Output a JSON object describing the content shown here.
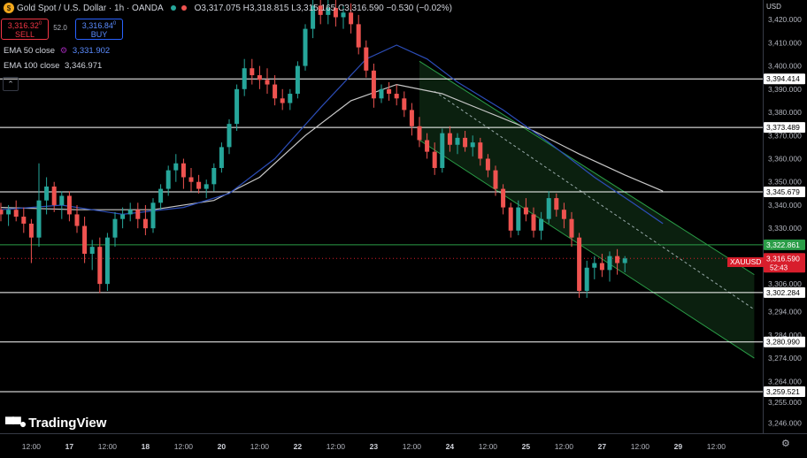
{
  "header": {
    "title": "Gold Spot / U.S. Dollar · 1h · OANDA",
    "ohlc": "O3,317.075 H3,318.815 L3,315.165 C3,316.590 −0.530 (−0.02%)"
  },
  "trade": {
    "sell_price": "3,316.32",
    "sell_sup": "0",
    "sell_label": "SELL",
    "spread": "52.0",
    "buy_price": "3,316.84",
    "buy_sup": "0",
    "buy_label": "BUY"
  },
  "indicators": {
    "ema50_label": "EMA 50 close",
    "ema50_value": "3,331.902",
    "ema100_label": "EMA 100 close",
    "ema100_value": "3,346.971"
  },
  "brand": "TradingView",
  "colors": {
    "up": "#26a69a",
    "down": "#ef5350",
    "ema50": "#2c4db8",
    "ema100": "#c8c8c8",
    "channel": "#2a9d47",
    "level": "#ffffff"
  },
  "chart_data": {
    "type": "candlestick",
    "currency": "USD",
    "symbol": "XAUUSD",
    "last_price": "3,316.590",
    "countdown": "52:43",
    "y_range": [
      3242,
      3425
    ],
    "y_ticks": [
      {
        "v": 3420,
        "label": "3,420.000"
      },
      {
        "v": 3410,
        "label": "3,410.000"
      },
      {
        "v": 3400,
        "label": "3,400.000"
      },
      {
        "v": 3390,
        "label": "3,390.000"
      },
      {
        "v": 3380,
        "label": "3,380.000"
      },
      {
        "v": 3370,
        "label": "3,370.000"
      },
      {
        "v": 3360,
        "label": "3,360.000"
      },
      {
        "v": 3350,
        "label": "3,350.000"
      },
      {
        "v": 3340,
        "label": "3,340.000"
      },
      {
        "v": 3330,
        "label": "3,330.000"
      },
      {
        "v": 3306,
        "label": "3,306.000"
      },
      {
        "v": 3294,
        "label": "3,294.000"
      },
      {
        "v": 3284,
        "label": "3,284.000"
      },
      {
        "v": 3274,
        "label": "3,274.000"
      },
      {
        "v": 3264,
        "label": "3,264.000"
      },
      {
        "v": 3255,
        "label": "3,255.000"
      },
      {
        "v": 3246,
        "label": "3,246.000"
      }
    ],
    "levels": [
      {
        "v": 3394.414,
        "label": "3,394.414"
      },
      {
        "v": 3373.489,
        "label": "3,373.489"
      },
      {
        "v": 3345.679,
        "label": "3,345.679"
      },
      {
        "v": 3302.284,
        "label": "3,302.284"
      },
      {
        "v": 3280.99,
        "label": "3,280.990"
      },
      {
        "v": 3259.521,
        "label": "3,259.521"
      }
    ],
    "green_level": {
      "v": 3322.861,
      "label": "3,322.861"
    },
    "x_ticks": [
      {
        "i": 4,
        "label": "12:00",
        "bold": false
      },
      {
        "i": 9,
        "label": "17",
        "bold": true
      },
      {
        "i": 14,
        "label": "12:00",
        "bold": false
      },
      {
        "i": 19,
        "label": "18",
        "bold": true
      },
      {
        "i": 24,
        "label": "12:00",
        "bold": false
      },
      {
        "i": 29,
        "label": "20",
        "bold": true
      },
      {
        "i": 34,
        "label": "12:00",
        "bold": false
      },
      {
        "i": 39,
        "label": "22",
        "bold": true
      },
      {
        "i": 44,
        "label": "12:00",
        "bold": false
      },
      {
        "i": 49,
        "label": "23",
        "bold": true
      },
      {
        "i": 54,
        "label": "12:00",
        "bold": false
      },
      {
        "i": 59,
        "label": "24",
        "bold": true
      },
      {
        "i": 64,
        "label": "12:00",
        "bold": false
      },
      {
        "i": 69,
        "label": "25",
        "bold": true
      },
      {
        "i": 74,
        "label": "12:00",
        "bold": false
      },
      {
        "i": 79,
        "label": "27",
        "bold": true
      },
      {
        "i": 84,
        "label": "12:00",
        "bold": false
      },
      {
        "i": 89,
        "label": "29",
        "bold": true
      },
      {
        "i": 94,
        "label": "12:00",
        "bold": false
      }
    ],
    "channel": {
      "upper": [
        [
          55,
          3402
        ],
        [
          99,
          3310
        ]
      ],
      "mid": [
        [
          57,
          3389
        ],
        [
          99,
          3295
        ]
      ],
      "lower": [
        [
          55,
          3368
        ],
        [
          99,
          3274
        ]
      ]
    },
    "candles": [
      [
        3338,
        3341,
        3333,
        3336
      ],
      [
        3336,
        3340,
        3331,
        3338
      ],
      [
        3338,
        3342,
        3333,
        3335
      ],
      [
        3335,
        3339,
        3328,
        3332
      ],
      [
        3332,
        3334,
        3315,
        3326
      ],
      [
        3326,
        3358,
        3322,
        3342
      ],
      [
        3342,
        3352,
        3336,
        3348
      ],
      [
        3348,
        3350,
        3337,
        3340
      ],
      [
        3340,
        3346,
        3334,
        3344
      ],
      [
        3344,
        3346,
        3333,
        3336
      ],
      [
        3336,
        3340,
        3328,
        3331
      ],
      [
        3331,
        3335,
        3315,
        3319
      ],
      [
        3319,
        3325,
        3312,
        3322
      ],
      [
        3322,
        3326,
        3302,
        3306
      ],
      [
        3306,
        3328,
        3303,
        3326
      ],
      [
        3326,
        3337,
        3322,
        3334
      ],
      [
        3334,
        3339,
        3330,
        3336
      ],
      [
        3336,
        3341,
        3333,
        3338
      ],
      [
        3338,
        3341,
        3330,
        3334
      ],
      [
        3334,
        3340,
        3327,
        3330
      ],
      [
        3330,
        3343,
        3328,
        3341
      ],
      [
        3341,
        3349,
        3338,
        3347
      ],
      [
        3347,
        3357,
        3344,
        3355
      ],
      [
        3355,
        3362,
        3350,
        3358
      ],
      [
        3358,
        3360,
        3347,
        3352
      ],
      [
        3352,
        3356,
        3346,
        3350
      ],
      [
        3350,
        3353,
        3345,
        3347
      ],
      [
        3347,
        3351,
        3343,
        3349
      ],
      [
        3349,
        3358,
        3346,
        3356
      ],
      [
        3356,
        3367,
        3354,
        3365
      ],
      [
        3365,
        3377,
        3362,
        3375
      ],
      [
        3375,
        3392,
        3372,
        3390
      ],
      [
        3390,
        3403,
        3387,
        3399
      ],
      [
        3399,
        3403,
        3392,
        3396
      ],
      [
        3396,
        3400,
        3390,
        3394
      ],
      [
        3394,
        3399,
        3388,
        3392
      ],
      [
        3392,
        3396,
        3383,
        3386
      ],
      [
        3386,
        3390,
        3381,
        3384
      ],
      [
        3384,
        3390,
        3381,
        3388
      ],
      [
        3388,
        3402,
        3386,
        3400
      ],
      [
        3400,
        3418,
        3398,
        3416
      ],
      [
        3416,
        3430,
        3412,
        3426
      ],
      [
        3426,
        3432,
        3418,
        3422
      ],
      [
        3422,
        3430,
        3418,
        3425
      ],
      [
        3425,
        3429,
        3417,
        3421
      ],
      [
        3421,
        3426,
        3416,
        3423
      ],
      [
        3423,
        3427,
        3414,
        3418
      ],
      [
        3418,
        3422,
        3405,
        3408
      ],
      [
        3408,
        3411,
        3395,
        3398
      ],
      [
        3398,
        3401,
        3382,
        3386
      ],
      [
        3386,
        3392,
        3384,
        3390
      ],
      [
        3390,
        3393,
        3385,
        3388
      ],
      [
        3388,
        3392,
        3383,
        3386
      ],
      [
        3386,
        3389,
        3378,
        3381
      ],
      [
        3381,
        3384,
        3370,
        3374
      ],
      [
        3374,
        3378,
        3365,
        3368
      ],
      [
        3368,
        3371,
        3360,
        3363
      ],
      [
        3363,
        3367,
        3353,
        3356
      ],
      [
        3356,
        3373,
        3354,
        3371
      ],
      [
        3371,
        3374,
        3363,
        3366
      ],
      [
        3366,
        3371,
        3362,
        3369
      ],
      [
        3369,
        3372,
        3363,
        3365
      ],
      [
        3365,
        3370,
        3361,
        3367
      ],
      [
        3367,
        3369,
        3357,
        3360
      ],
      [
        3360,
        3362,
        3352,
        3355
      ],
      [
        3355,
        3357,
        3344,
        3347
      ],
      [
        3347,
        3349,
        3336,
        3339
      ],
      [
        3339,
        3341,
        3326,
        3329
      ],
      [
        3329,
        3342,
        3327,
        3339
      ],
      [
        3339,
        3343,
        3333,
        3336
      ],
      [
        3336,
        3339,
        3326,
        3329
      ],
      [
        3329,
        3337,
        3325,
        3334
      ],
      [
        3334,
        3346,
        3332,
        3343
      ],
      [
        3343,
        3345,
        3335,
        3338
      ],
      [
        3338,
        3341,
        3330,
        3334
      ],
      [
        3334,
        3337,
        3322,
        3326
      ],
      [
        3326,
        3328,
        3300,
        3303
      ],
      [
        3303,
        3316,
        3300,
        3313
      ],
      [
        3313,
        3318,
        3308,
        3315
      ],
      [
        3315,
        3319,
        3309,
        3312
      ],
      [
        3312,
        3320,
        3307,
        3318
      ],
      [
        3318,
        3321,
        3310,
        3315
      ],
      [
        3315,
        3318,
        3311,
        3317
      ]
    ],
    "ema50": [
      [
        0,
        3338
      ],
      [
        8,
        3340
      ],
      [
        16,
        3336
      ],
      [
        24,
        3339
      ],
      [
        30,
        3345
      ],
      [
        36,
        3360
      ],
      [
        42,
        3382
      ],
      [
        48,
        3403
      ],
      [
        52,
        3409
      ],
      [
        56,
        3403
      ],
      [
        60,
        3393
      ],
      [
        66,
        3381
      ],
      [
        72,
        3367
      ],
      [
        78,
        3352
      ],
      [
        83,
        3341
      ],
      [
        87,
        3332
      ]
    ],
    "ema100": [
      [
        0,
        3339
      ],
      [
        10,
        3338
      ],
      [
        20,
        3338
      ],
      [
        28,
        3342
      ],
      [
        34,
        3352
      ],
      [
        40,
        3370
      ],
      [
        46,
        3385
      ],
      [
        52,
        3392
      ],
      [
        58,
        3388
      ],
      [
        64,
        3380
      ],
      [
        70,
        3372
      ],
      [
        76,
        3362
      ],
      [
        82,
        3353
      ],
      [
        87,
        3346
      ]
    ]
  }
}
